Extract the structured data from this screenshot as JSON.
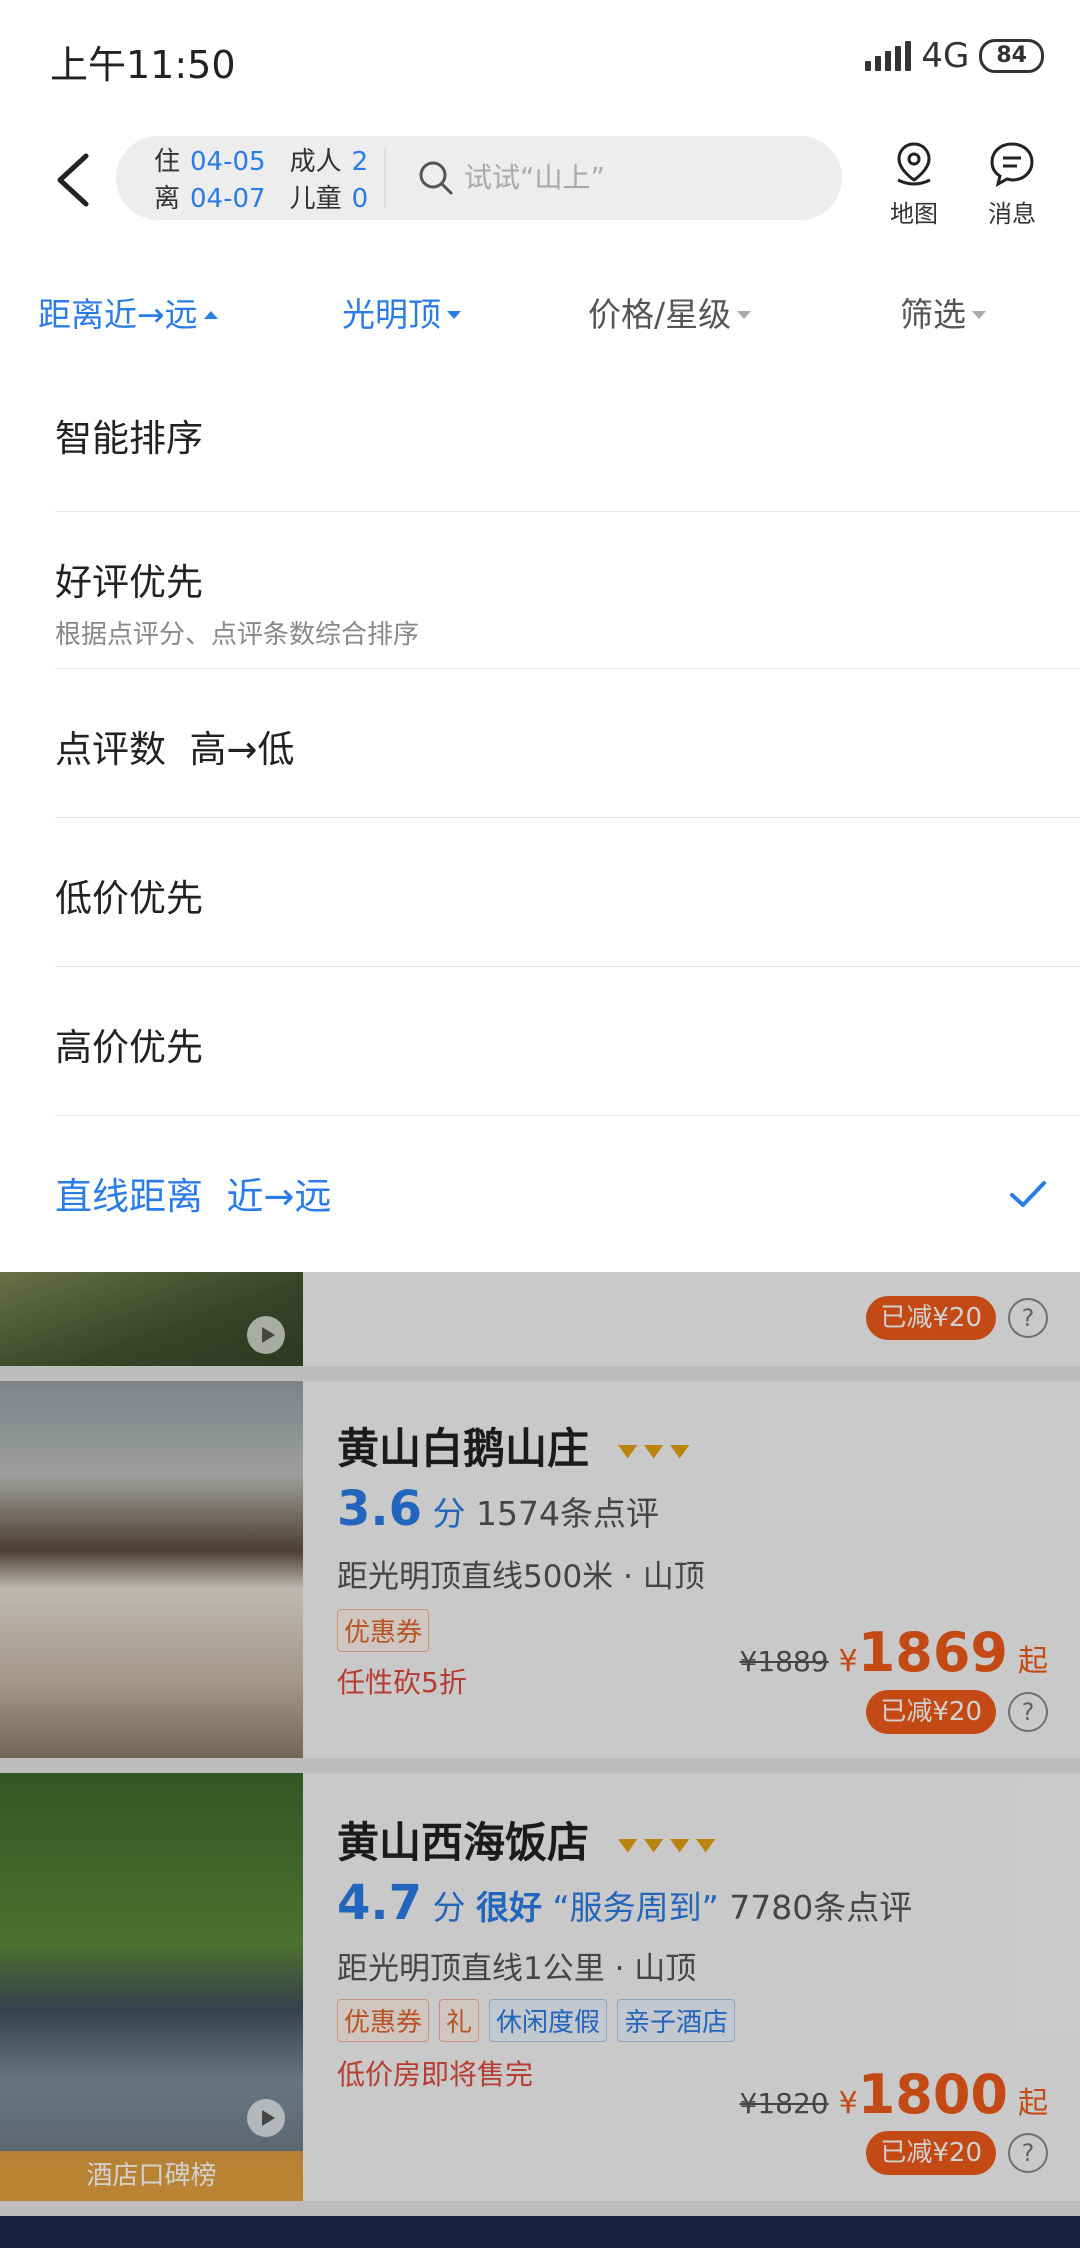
{
  "status_bar": {
    "time": "上午11:50",
    "network": "4G",
    "battery": "84"
  },
  "search": {
    "checkin_label": "住",
    "checkin_date": "04-05",
    "checkout_label": "离",
    "checkout_date": "04-07",
    "adult_label": "成人",
    "adult_count": "2",
    "child_label": "儿童",
    "child_count": "0",
    "placeholder": "试试“山上”"
  },
  "header_buttons": {
    "map_label": "地图",
    "message_label": "消息"
  },
  "tabs": [
    {
      "label": "距离近→远"
    },
    {
      "label": "光明顶"
    },
    {
      "label": "价格/星级"
    },
    {
      "label": "筛选"
    }
  ],
  "sort_options": [
    {
      "title": "智能排序",
      "subtitle": ""
    },
    {
      "title": "好评优先",
      "subtitle": "根据点评分、点评条数综合排序"
    },
    {
      "title": "点评数  高→低",
      "subtitle": ""
    },
    {
      "title": "低价优先",
      "subtitle": ""
    },
    {
      "title": "高价优先",
      "subtitle": ""
    },
    {
      "title": "直线距离  近→远",
      "subtitle": "",
      "selected": true
    }
  ],
  "hotels": [
    {
      "discount": "已减¥20"
    },
    {
      "name": "黄山白鹅山庄",
      "diamond_count": 3,
      "score": "3.6",
      "score_unit": "分",
      "review_count": "1574条点评",
      "distance": "距光明顶直线500米 · 山顶",
      "tags": [
        "优惠券"
      ],
      "note": "任性砍5折",
      "original_price": "¥1889",
      "currency": "¥",
      "price": "1869",
      "price_suffix": "起",
      "discount": "已减¥20"
    },
    {
      "name": "黄山西海饭店",
      "diamond_count": 4,
      "score": "4.7",
      "score_unit": "分",
      "rating_word": "很好",
      "quote": "“服务周到”",
      "review_count": "7780条点评",
      "distance": "距光明顶直线1公里 · 山顶",
      "tags": [
        "优惠券",
        "礼",
        "休闲度假",
        "亲子酒店"
      ],
      "note": "低价房即将售完",
      "original_price": "¥1820",
      "currency": "¥",
      "price": "1800",
      "price_suffix": "起",
      "discount": "已减¥20",
      "badge": "酒店口碑榜"
    }
  ],
  "colors": {
    "accent": "#2a7ce6",
    "price": "#ee5a1a",
    "star": "#e3a212"
  }
}
